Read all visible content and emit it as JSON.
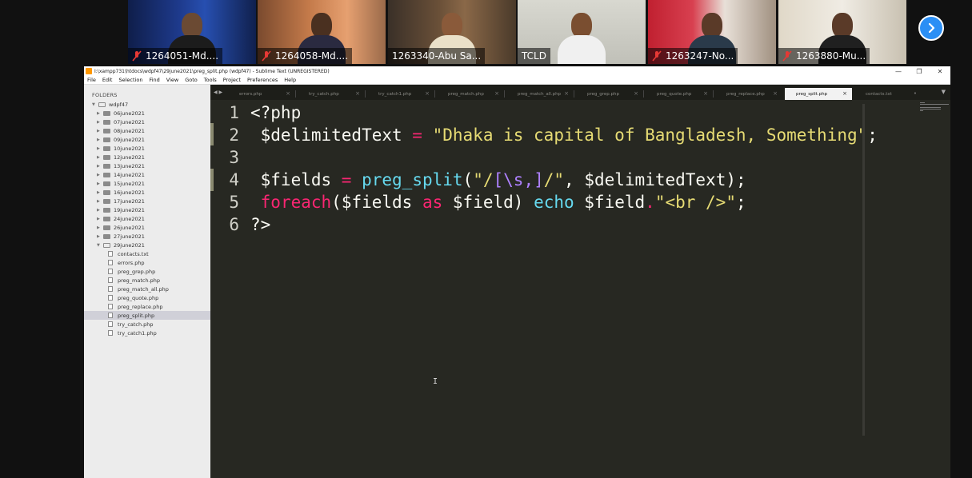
{
  "participants": [
    {
      "name": "1264051-Md....",
      "muted": true
    },
    {
      "name": "1264058-Md....",
      "muted": true
    },
    {
      "name": "1263340-Abu Sa...",
      "muted": false
    },
    {
      "name": "TCLD",
      "muted": false,
      "active": true
    },
    {
      "name": "1263247-No...",
      "muted": true
    },
    {
      "name": "1263880-Mu...",
      "muted": true
    }
  ],
  "window": {
    "title": "I:\\xampp731\\htdocs\\wdpf47\\29june2021\\preg_split.php (wdpf47) - Sublime Text (UNREGISTERED)",
    "minimize": "—",
    "restore": "❐",
    "close": "✕"
  },
  "menu": [
    "File",
    "Edit",
    "Selection",
    "Find",
    "View",
    "Goto",
    "Tools",
    "Project",
    "Preferences",
    "Help"
  ],
  "sidebar": {
    "header": "FOLDERS",
    "root": "wdpf47",
    "folders": [
      "06june2021",
      "07june2021",
      "08june2021",
      "09june2021",
      "10june2021",
      "12june2021",
      "13june2021",
      "14june2021",
      "15june2021",
      "16june2021",
      "17june2021",
      "19june2021",
      "24june2021",
      "26june2021",
      "27june2021",
      "29june2021"
    ],
    "files": [
      "contacts.txt",
      "errors.php",
      "preg_grep.php",
      "preg_match.php",
      "preg_match_all.php",
      "preg_quote.php",
      "preg_replace.php",
      "preg_split.php",
      "try_catch.php",
      "try_catch1.php"
    ]
  },
  "tabs": [
    "errors.php",
    "try_catch.php",
    "try_catch1.php",
    "preg_match.php",
    "preg_match_all.php",
    "preg_grep.php",
    "preg_quote.php",
    "preg_replace.php",
    "preg_split.php",
    "contacts.txt"
  ],
  "active_tab": "preg_split.php",
  "code_lines": [
    {
      "n": "1",
      "text": "<?php"
    },
    {
      "n": "2",
      "text": " $delimitedText = \"Dhaka is capital of Bangladesh, Something\";"
    },
    {
      "n": "3",
      "text": ""
    },
    {
      "n": "4",
      "text": " $fields = preg_split(\"/[\\s,]/\", $delimitedText);"
    },
    {
      "n": "5",
      "text": " foreach($fields as $field) echo $field.\"<br />\";"
    },
    {
      "n": "6",
      "text": "?>"
    }
  ],
  "colors": {
    "editor_bg": "#272822",
    "keyword": "#f92672",
    "function": "#66d9ef",
    "string": "#e6db74",
    "escape": "#ae81ff",
    "accent_button": "#2b8ff5"
  }
}
